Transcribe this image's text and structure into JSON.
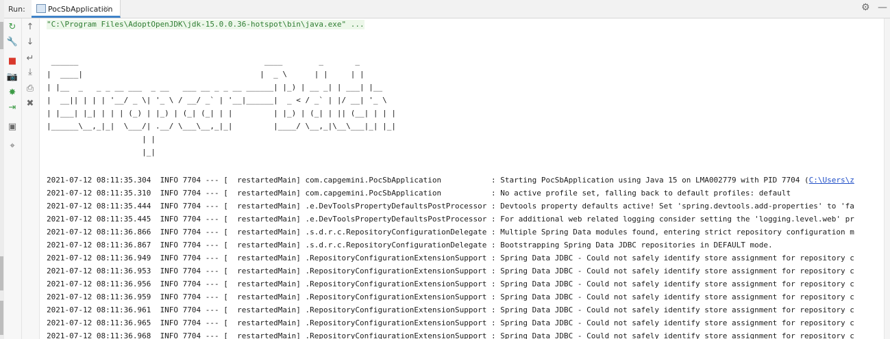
{
  "tool_window": {
    "run_label": "Run:",
    "tab_label": "PocSbApplication",
    "close_glyph": "×",
    "settings_glyph": "⚙",
    "hide_glyph": "—"
  },
  "toolbar_col1": [
    {
      "name": "rerun-icon",
      "glyph": "↻",
      "color": "#3d9b46"
    },
    {
      "name": "wrench-icon",
      "glyph": "🔧",
      "color": "#6b6b6b"
    },
    {
      "name": "stop-icon",
      "glyph": "■",
      "color": "#d9392c"
    },
    {
      "name": "camera-icon",
      "glyph": "📷",
      "color": "#6b6b6b"
    },
    {
      "name": "debug-bug-icon",
      "glyph": "✸",
      "color": "#3d9b46"
    },
    {
      "name": "exit-icon",
      "glyph": "⇥",
      "color": "#3d9b46"
    },
    {
      "name": "layout-icon",
      "glyph": "▣",
      "color": "#6b6b6b"
    },
    {
      "name": "pin-icon",
      "glyph": "⌖",
      "color": "#6b6b6b"
    }
  ],
  "toolbar_col2": [
    {
      "name": "scroll-up-icon",
      "glyph": "↑"
    },
    {
      "name": "scroll-down-icon",
      "glyph": "↓"
    },
    {
      "name": "soft-wrap-icon",
      "glyph": "↵"
    },
    {
      "name": "scroll-to-end-icon",
      "glyph": "⤓"
    },
    {
      "name": "print-icon",
      "glyph": "⎙"
    },
    {
      "name": "trash-icon",
      "glyph": "✖"
    }
  ],
  "console": {
    "command": "\"C:\\Program Files\\AdoptOpenJDK\\jdk-15.0.0.36-hotspot\\bin\\java.exe\" ...",
    "banner": [
      " ______                                         ____        _       _",
      "|  ____|                                       |  _ \\      | |     | |",
      "| |__  _   _ _ __ ___  _ __   ___ __ _ _ __ ______| |_) | __ _| | ___| |__",
      "|  __|| | | | '__/ _ \\| '_ \\ / __/ _` | '__|______|  _ < / _` | |/ __| '_ \\",
      "| |___| |_| | | | (_) | |_) | (_| (_| | |         | |_) | (_| | || (__| | | |",
      "|______\\__,_|_|  \\___/| .__/ \\___\\__,_|_|         |____/ \\__,_|\\__\\___|_| |_|",
      "                     | |",
      "                     |_|"
    ],
    "logs": [
      "2021-07-12 08:11:35.304  INFO 7704 --- [  restartedMain] com.capgemini.PocSbApplication           : Starting PocSbApplication using Java 15 on LMA002779 with PID 7704 (",
      "2021-07-12 08:11:35.310  INFO 7704 --- [  restartedMain] com.capgemini.PocSbApplication           : No active profile set, falling back to default profiles: default",
      "2021-07-12 08:11:35.444  INFO 7704 --- [  restartedMain] .e.DevToolsPropertyDefaultsPostProcessor : Devtools property defaults active! Set 'spring.devtools.add-properties' to 'fa",
      "2021-07-12 08:11:35.445  INFO 7704 --- [  restartedMain] .e.DevToolsPropertyDefaultsPostProcessor : For additional web related logging consider setting the 'logging.level.web' pr",
      "2021-07-12 08:11:36.866  INFO 7704 --- [  restartedMain] .s.d.r.c.RepositoryConfigurationDelegate : Multiple Spring Data modules found, entering strict repository configuration m",
      "2021-07-12 08:11:36.867  INFO 7704 --- [  restartedMain] .s.d.r.c.RepositoryConfigurationDelegate : Bootstrapping Spring Data JDBC repositories in DEFAULT mode.",
      "2021-07-12 08:11:36.949  INFO 7704 --- [  restartedMain] .RepositoryConfigurationExtensionSupport : Spring Data JDBC - Could not safely identify store assignment for repository c",
      "2021-07-12 08:11:36.953  INFO 7704 --- [  restartedMain] .RepositoryConfigurationExtensionSupport : Spring Data JDBC - Could not safely identify store assignment for repository c",
      "2021-07-12 08:11:36.956  INFO 7704 --- [  restartedMain] .RepositoryConfigurationExtensionSupport : Spring Data JDBC - Could not safely identify store assignment for repository c",
      "2021-07-12 08:11:36.959  INFO 7704 --- [  restartedMain] .RepositoryConfigurationExtensionSupport : Spring Data JDBC - Could not safely identify store assignment for repository c",
      "2021-07-12 08:11:36.961  INFO 7704 --- [  restartedMain] .RepositoryConfigurationExtensionSupport : Spring Data JDBC - Could not safely identify store assignment for repository c",
      "2021-07-12 08:11:36.965  INFO 7704 --- [  restartedMain] .RepositoryConfigurationExtensionSupport : Spring Data JDBC - Could not safely identify store assignment for repository c",
      "2021-07-12 08:11:36.968  INFO 7704 --- [  restartedMain] .RepositoryConfigurationExtensionSupport : Spring Data JDBC - Could not safely identify store assignment for repository c"
    ],
    "first_log_link": "C:\\Users\\z"
  }
}
